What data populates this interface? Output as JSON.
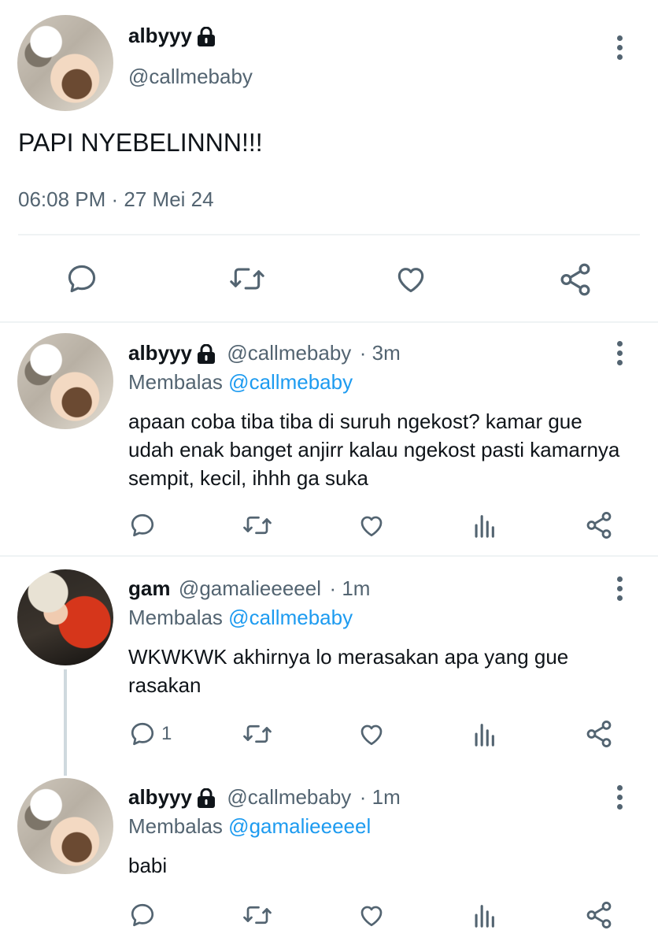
{
  "main_tweet": {
    "name": "albyyy",
    "handle": "@callmebaby",
    "text": "PAPI NYEBELINNN!!!",
    "timestamp": "06:08 PM · 27 Mei 24"
  },
  "replies": [
    {
      "name": "albyyy",
      "handle": "@callmebaby",
      "time": "· 3m",
      "replying_prefix": "Membalas",
      "replying_to": "@callmebaby",
      "text": "apaan coba tiba tiba di suruh ngekost? kamar gue udah enak banget anjirr kalau ngekost pasti kamarnya sempit, kecil, ihhh ga suka"
    },
    {
      "name": "gam",
      "handle": "@gamalieeeeel",
      "time": "· 1m",
      "replying_prefix": "Membalas",
      "replying_to": "@callmebaby",
      "text": "WKWKWK akhirnya lo merasakan apa yang gue rasakan",
      "reply_count": "1"
    },
    {
      "name": "albyyy",
      "handle": "@callmebaby",
      "time": "· 1m",
      "replying_prefix": "Membalas",
      "replying_to": "@gamalieeeeel",
      "text": "babi"
    }
  ],
  "colors": {
    "text": "#0f1419",
    "secondary": "#536471",
    "accent": "#1d9bf0",
    "divider": "#eff3f4"
  },
  "icons": [
    "lock-icon",
    "more-icon",
    "reply-icon",
    "retweet-icon",
    "like-icon",
    "share-icon",
    "analytics-icon"
  ]
}
